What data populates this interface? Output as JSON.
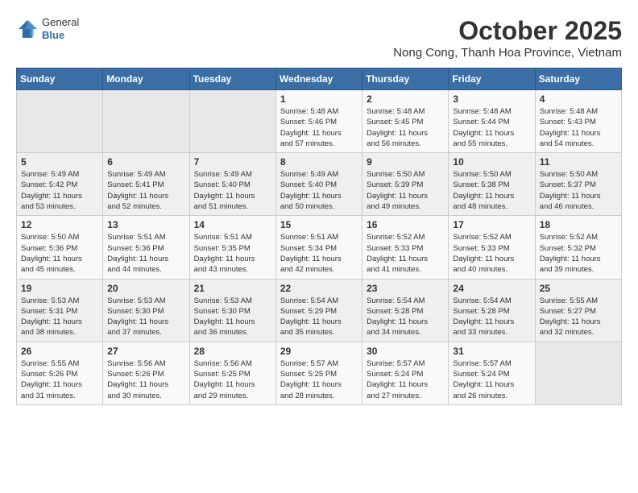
{
  "header": {
    "logo_general": "General",
    "logo_blue": "Blue",
    "month_year": "October 2025",
    "location": "Nong Cong, Thanh Hoa Province, Vietnam"
  },
  "days_of_week": [
    "Sunday",
    "Monday",
    "Tuesday",
    "Wednesday",
    "Thursday",
    "Friday",
    "Saturday"
  ],
  "weeks": [
    [
      {
        "day": "",
        "info": ""
      },
      {
        "day": "",
        "info": ""
      },
      {
        "day": "",
        "info": ""
      },
      {
        "day": "1",
        "info": "Sunrise: 5:48 AM\nSunset: 5:46 PM\nDaylight: 11 hours\nand 57 minutes."
      },
      {
        "day": "2",
        "info": "Sunrise: 5:48 AM\nSunset: 5:45 PM\nDaylight: 11 hours\nand 56 minutes."
      },
      {
        "day": "3",
        "info": "Sunrise: 5:48 AM\nSunset: 5:44 PM\nDaylight: 11 hours\nand 55 minutes."
      },
      {
        "day": "4",
        "info": "Sunrise: 5:48 AM\nSunset: 5:43 PM\nDaylight: 11 hours\nand 54 minutes."
      }
    ],
    [
      {
        "day": "5",
        "info": "Sunrise: 5:49 AM\nSunset: 5:42 PM\nDaylight: 11 hours\nand 53 minutes."
      },
      {
        "day": "6",
        "info": "Sunrise: 5:49 AM\nSunset: 5:41 PM\nDaylight: 11 hours\nand 52 minutes."
      },
      {
        "day": "7",
        "info": "Sunrise: 5:49 AM\nSunset: 5:40 PM\nDaylight: 11 hours\nand 51 minutes."
      },
      {
        "day": "8",
        "info": "Sunrise: 5:49 AM\nSunset: 5:40 PM\nDaylight: 11 hours\nand 50 minutes."
      },
      {
        "day": "9",
        "info": "Sunrise: 5:50 AM\nSunset: 5:39 PM\nDaylight: 11 hours\nand 49 minutes."
      },
      {
        "day": "10",
        "info": "Sunrise: 5:50 AM\nSunset: 5:38 PM\nDaylight: 11 hours\nand 48 minutes."
      },
      {
        "day": "11",
        "info": "Sunrise: 5:50 AM\nSunset: 5:37 PM\nDaylight: 11 hours\nand 46 minutes."
      }
    ],
    [
      {
        "day": "12",
        "info": "Sunrise: 5:50 AM\nSunset: 5:36 PM\nDaylight: 11 hours\nand 45 minutes."
      },
      {
        "day": "13",
        "info": "Sunrise: 5:51 AM\nSunset: 5:36 PM\nDaylight: 11 hours\nand 44 minutes."
      },
      {
        "day": "14",
        "info": "Sunrise: 5:51 AM\nSunset: 5:35 PM\nDaylight: 11 hours\nand 43 minutes."
      },
      {
        "day": "15",
        "info": "Sunrise: 5:51 AM\nSunset: 5:34 PM\nDaylight: 11 hours\nand 42 minutes."
      },
      {
        "day": "16",
        "info": "Sunrise: 5:52 AM\nSunset: 5:33 PM\nDaylight: 11 hours\nand 41 minutes."
      },
      {
        "day": "17",
        "info": "Sunrise: 5:52 AM\nSunset: 5:33 PM\nDaylight: 11 hours\nand 40 minutes."
      },
      {
        "day": "18",
        "info": "Sunrise: 5:52 AM\nSunset: 5:32 PM\nDaylight: 11 hours\nand 39 minutes."
      }
    ],
    [
      {
        "day": "19",
        "info": "Sunrise: 5:53 AM\nSunset: 5:31 PM\nDaylight: 11 hours\nand 38 minutes."
      },
      {
        "day": "20",
        "info": "Sunrise: 5:53 AM\nSunset: 5:30 PM\nDaylight: 11 hours\nand 37 minutes."
      },
      {
        "day": "21",
        "info": "Sunrise: 5:53 AM\nSunset: 5:30 PM\nDaylight: 11 hours\nand 36 minutes."
      },
      {
        "day": "22",
        "info": "Sunrise: 5:54 AM\nSunset: 5:29 PM\nDaylight: 11 hours\nand 35 minutes."
      },
      {
        "day": "23",
        "info": "Sunrise: 5:54 AM\nSunset: 5:28 PM\nDaylight: 11 hours\nand 34 minutes."
      },
      {
        "day": "24",
        "info": "Sunrise: 5:54 AM\nSunset: 5:28 PM\nDaylight: 11 hours\nand 33 minutes."
      },
      {
        "day": "25",
        "info": "Sunrise: 5:55 AM\nSunset: 5:27 PM\nDaylight: 11 hours\nand 32 minutes."
      }
    ],
    [
      {
        "day": "26",
        "info": "Sunrise: 5:55 AM\nSunset: 5:26 PM\nDaylight: 11 hours\nand 31 minutes."
      },
      {
        "day": "27",
        "info": "Sunrise: 5:56 AM\nSunset: 5:26 PM\nDaylight: 11 hours\nand 30 minutes."
      },
      {
        "day": "28",
        "info": "Sunrise: 5:56 AM\nSunset: 5:25 PM\nDaylight: 11 hours\nand 29 minutes."
      },
      {
        "day": "29",
        "info": "Sunrise: 5:57 AM\nSunset: 5:25 PM\nDaylight: 11 hours\nand 28 minutes."
      },
      {
        "day": "30",
        "info": "Sunrise: 5:57 AM\nSunset: 5:24 PM\nDaylight: 11 hours\nand 27 minutes."
      },
      {
        "day": "31",
        "info": "Sunrise: 5:57 AM\nSunset: 5:24 PM\nDaylight: 11 hours\nand 26 minutes."
      },
      {
        "day": "",
        "info": ""
      }
    ]
  ]
}
